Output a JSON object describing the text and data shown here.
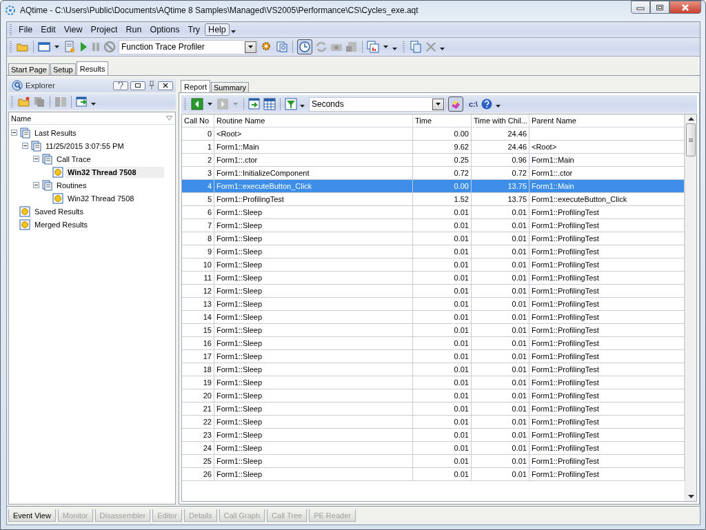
{
  "window": {
    "title": "AQtime - C:\\Users\\Public\\Documents\\AQtime 8 Samples\\Managed\\VS2005\\Performance\\CS\\Cycles_exe.aqt"
  },
  "menu": [
    {
      "label": "File",
      "selected": false
    },
    {
      "label": "Edit",
      "selected": false
    },
    {
      "label": "View",
      "selected": false
    },
    {
      "label": "Project",
      "selected": false
    },
    {
      "label": "Run",
      "selected": false
    },
    {
      "label": "Options",
      "selected": false
    },
    {
      "label": "Try",
      "selected": false
    },
    {
      "label": "Help",
      "selected": true
    }
  ],
  "toolbar": {
    "profiler": "Function Trace Profiler"
  },
  "main_tabs": [
    {
      "label": "Start Page",
      "selected": false
    },
    {
      "label": "Setup",
      "selected": false
    },
    {
      "label": "Results",
      "selected": true
    }
  ],
  "explorer": {
    "title": "Explorer",
    "column": "Name",
    "tree": [
      {
        "label": "Last Results",
        "expanded": true,
        "selected": false,
        "children": [
          {
            "label": "11/25/2015 3:07:55 PM",
            "expanded": true,
            "selected": false,
            "children": [
              {
                "label": "Call Trace",
                "expanded": true,
                "selected": false,
                "children": [
                  {
                    "label": "Win32 Thread 7508",
                    "selected": true
                  }
                ]
              },
              {
                "label": "Routines",
                "expanded": true,
                "selected": false,
                "children": [
                  {
                    "label": "Win32 Thread 7508",
                    "selected": false
                  }
                ]
              }
            ]
          }
        ]
      },
      {
        "label": "Saved Results",
        "selected": false
      },
      {
        "label": "Merged Results",
        "selected": false
      }
    ]
  },
  "report_tabs": [
    {
      "label": "Report",
      "selected": true
    },
    {
      "label": "Summary",
      "selected": false
    }
  ],
  "report_toolbar": {
    "units": "Seconds",
    "path": "c:\\"
  },
  "table": {
    "columns": [
      "Call No",
      "Routine Name",
      "Time",
      "Time with Chil...",
      "Parent Name"
    ],
    "rows": [
      {
        "cells": [
          "0",
          "<Root>",
          "0.00",
          "24.46",
          ""
        ],
        "selected": false
      },
      {
        "cells": [
          "1",
          "Form1::Main",
          "9.62",
          "24.46",
          "<Root>"
        ],
        "selected": false
      },
      {
        "cells": [
          "2",
          "Form1::.ctor",
          "0.25",
          "0.96",
          "Form1::Main"
        ],
        "selected": false
      },
      {
        "cells": [
          "3",
          "Form1::InitializeComponent",
          "0.72",
          "0.72",
          "Form1::.ctor"
        ],
        "selected": false
      },
      {
        "cells": [
          "4",
          "Form1::executeButton_Click",
          "0.00",
          "13.75",
          "Form1::Main"
        ],
        "selected": true
      },
      {
        "cells": [
          "5",
          "Form1::ProfilingTest",
          "1.52",
          "13.75",
          "Form1::executeButton_Click"
        ],
        "selected": false
      },
      {
        "cells": [
          "6",
          "Form1::Sleep",
          "0.01",
          "0.01",
          "Form1::ProfilingTest"
        ],
        "selected": false
      },
      {
        "cells": [
          "7",
          "Form1::Sleep",
          "0.01",
          "0.01",
          "Form1::ProfilingTest"
        ],
        "selected": false
      },
      {
        "cells": [
          "8",
          "Form1::Sleep",
          "0.01",
          "0.01",
          "Form1::ProfilingTest"
        ],
        "selected": false
      },
      {
        "cells": [
          "9",
          "Form1::Sleep",
          "0.01",
          "0.01",
          "Form1::ProfilingTest"
        ],
        "selected": false
      },
      {
        "cells": [
          "10",
          "Form1::Sleep",
          "0.01",
          "0.01",
          "Form1::ProfilingTest"
        ],
        "selected": false
      },
      {
        "cells": [
          "11",
          "Form1::Sleep",
          "0.01",
          "0.01",
          "Form1::ProfilingTest"
        ],
        "selected": false
      },
      {
        "cells": [
          "12",
          "Form1::Sleep",
          "0.01",
          "0.01",
          "Form1::ProfilingTest"
        ],
        "selected": false
      },
      {
        "cells": [
          "13",
          "Form1::Sleep",
          "0.01",
          "0.01",
          "Form1::ProfilingTest"
        ],
        "selected": false
      },
      {
        "cells": [
          "14",
          "Form1::Sleep",
          "0.01",
          "0.01",
          "Form1::ProfilingTest"
        ],
        "selected": false
      },
      {
        "cells": [
          "15",
          "Form1::Sleep",
          "0.01",
          "0.01",
          "Form1::ProfilingTest"
        ],
        "selected": false
      },
      {
        "cells": [
          "16",
          "Form1::Sleep",
          "0.01",
          "0.01",
          "Form1::ProfilingTest"
        ],
        "selected": false
      },
      {
        "cells": [
          "17",
          "Form1::Sleep",
          "0.01",
          "0.01",
          "Form1::ProfilingTest"
        ],
        "selected": false
      },
      {
        "cells": [
          "18",
          "Form1::Sleep",
          "0.01",
          "0.01",
          "Form1::ProfilingTest"
        ],
        "selected": false
      },
      {
        "cells": [
          "19",
          "Form1::Sleep",
          "0.01",
          "0.01",
          "Form1::ProfilingTest"
        ],
        "selected": false
      },
      {
        "cells": [
          "20",
          "Form1::Sleep",
          "0.01",
          "0.01",
          "Form1::ProfilingTest"
        ],
        "selected": false
      },
      {
        "cells": [
          "21",
          "Form1::Sleep",
          "0.01",
          "0.01",
          "Form1::ProfilingTest"
        ],
        "selected": false
      },
      {
        "cells": [
          "22",
          "Form1::Sleep",
          "0.01",
          "0.01",
          "Form1::ProfilingTest"
        ],
        "selected": false
      },
      {
        "cells": [
          "23",
          "Form1::Sleep",
          "0.01",
          "0.01",
          "Form1::ProfilingTest"
        ],
        "selected": false
      },
      {
        "cells": [
          "24",
          "Form1::Sleep",
          "0.01",
          "0.01",
          "Form1::ProfilingTest"
        ],
        "selected": false
      },
      {
        "cells": [
          "25",
          "Form1::Sleep",
          "0.01",
          "0.01",
          "Form1::ProfilingTest"
        ],
        "selected": false
      },
      {
        "cells": [
          "26",
          "Form1::Sleep",
          "0.01",
          "0.01",
          "Form1::ProfilingTest"
        ],
        "selected": false
      }
    ]
  },
  "bottom_tabs": [
    {
      "label": "Event View",
      "disabled": false
    },
    {
      "label": "Monitor",
      "disabled": true
    },
    {
      "label": "Disassembler",
      "disabled": true
    },
    {
      "label": "Editor",
      "disabled": true
    },
    {
      "label": "Details",
      "disabled": true
    },
    {
      "label": "Call Graph",
      "disabled": true
    },
    {
      "label": "Call Tree",
      "disabled": true
    },
    {
      "label": "PE Reader",
      "disabled": true
    }
  ]
}
